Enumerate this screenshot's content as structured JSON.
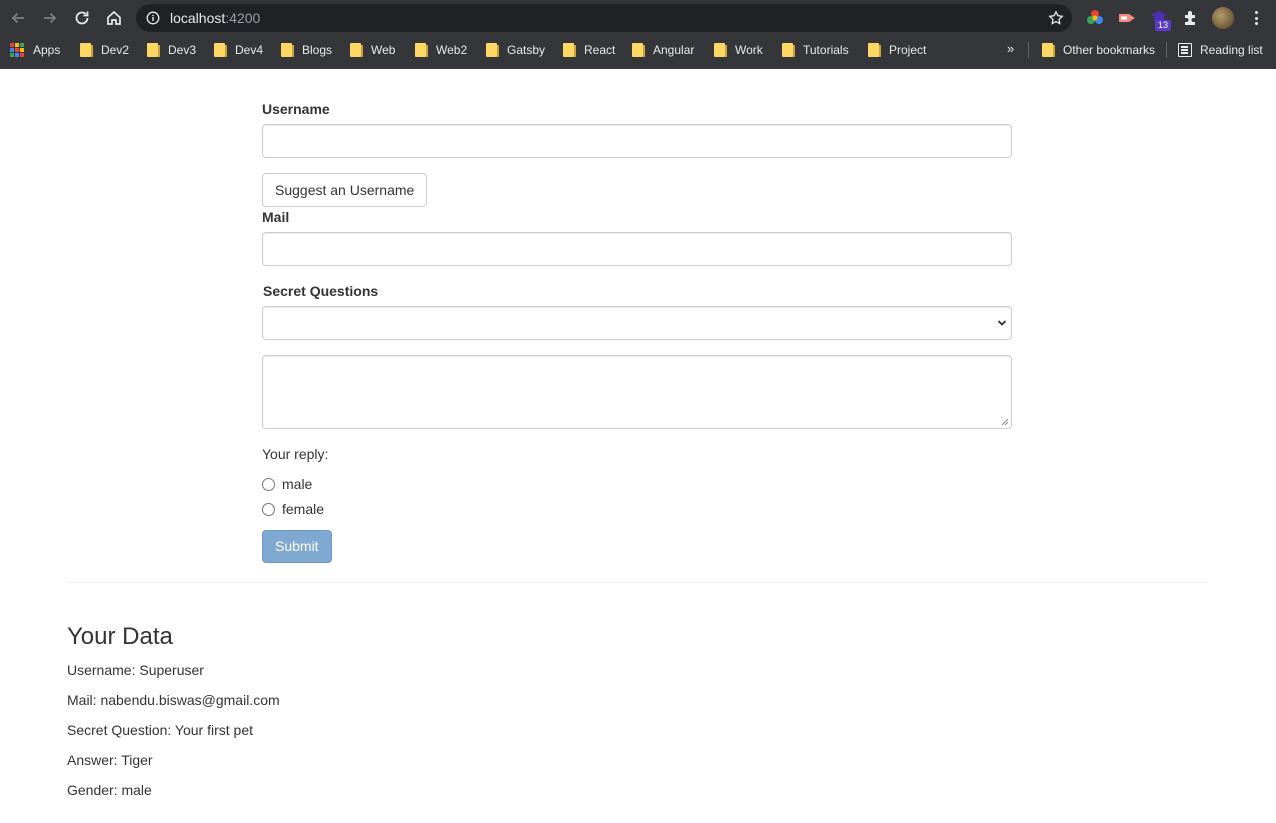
{
  "browser": {
    "url_host": "localhost",
    "url_port": ":4200",
    "extension_badge": "13",
    "bookmarks": [
      "Apps",
      "Dev2",
      "Dev3",
      "Dev4",
      "Blogs",
      "Web",
      "Web2",
      "Gatsby",
      "React",
      "Angular",
      "Work",
      "Tutorials",
      "Project"
    ],
    "overflow_chevron": "»",
    "other_bookmarks": "Other bookmarks",
    "reading_list": "Reading list"
  },
  "form": {
    "username_label": "Username",
    "username_value": "",
    "suggest_button": "Suggest an Username",
    "mail_label": "Mail",
    "mail_value": "",
    "secret_label": "Secret Questions",
    "secret_selected": "",
    "answer_value": "",
    "reply_label": "Your reply:",
    "gender_options": [
      "male",
      "female"
    ],
    "submit_button": "Submit"
  },
  "results": {
    "title": "Your Data",
    "lines": [
      "Username: Superuser",
      "Mail: nabendu.biswas@gmail.com",
      "Secret Question: Your first pet",
      "Answer: Tiger",
      "Gender: male"
    ]
  },
  "colors": {
    "chrome_bg": "#35363a",
    "omnibox_bg": "#202124",
    "folder": "#fdd663",
    "primary_button": "#7fa9d3",
    "text": "#333333"
  }
}
